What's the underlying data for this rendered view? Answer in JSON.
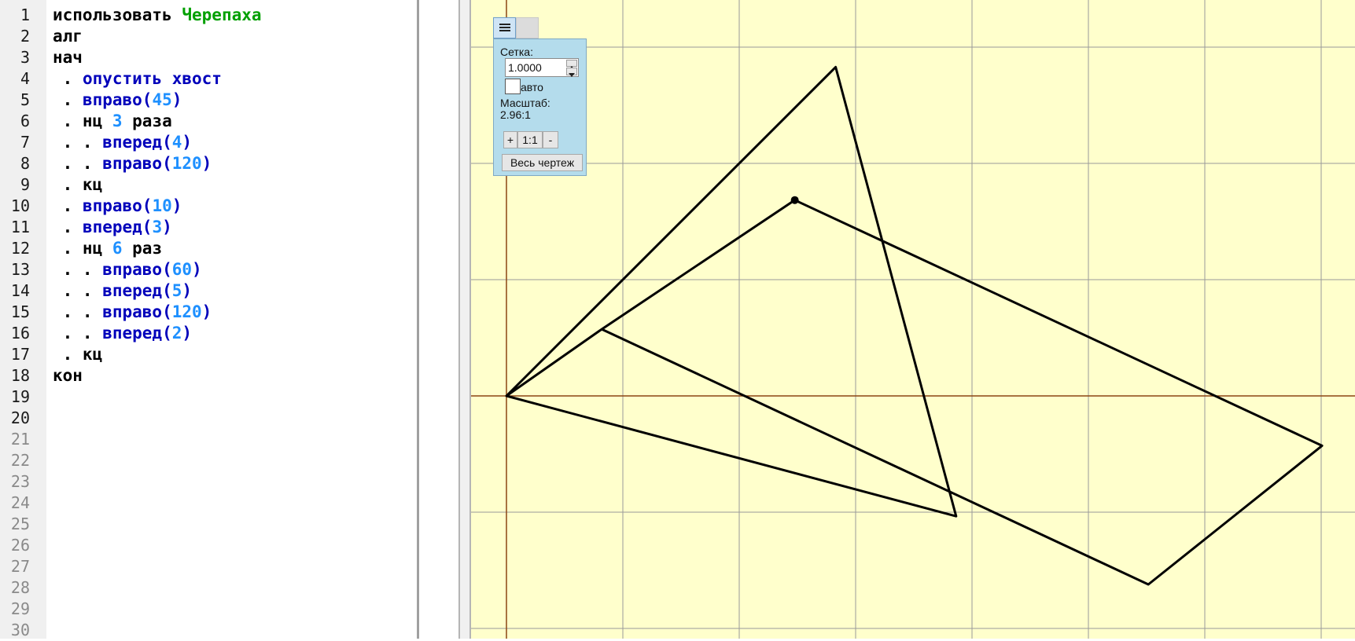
{
  "editor": {
    "line_numbers": [
      "1",
      "2",
      "3",
      "4",
      "5",
      "6",
      "7",
      "8",
      "9",
      "10",
      "11",
      "12",
      "13",
      "14",
      "15",
      "16",
      "17",
      "18",
      "19",
      "20",
      "21",
      "22",
      "23",
      "24",
      "25",
      "26",
      "27",
      "28",
      "29",
      "30"
    ],
    "lines": [
      [
        {
          "t": "использовать ",
          "c": "kw"
        },
        {
          "t": "Черепаха",
          "c": "mod"
        }
      ],
      [
        {
          "t": "алг",
          "c": "kw"
        }
      ],
      [
        {
          "t": "нач",
          "c": "kw"
        }
      ],
      [
        {
          "t": " . ",
          "c": "kw"
        },
        {
          "t": "опустить хвост",
          "c": "cmd"
        }
      ],
      [
        {
          "t": " . ",
          "c": "kw"
        },
        {
          "t": "вправо",
          "c": "cmd"
        },
        {
          "t": "(",
          "c": "par"
        },
        {
          "t": "45",
          "c": "num"
        },
        {
          "t": ")",
          "c": "par"
        }
      ],
      [
        {
          "t": " . нц ",
          "c": "kw"
        },
        {
          "t": "3",
          "c": "num"
        },
        {
          "t": " раза",
          "c": "kw"
        }
      ],
      [
        {
          "t": " . . ",
          "c": "kw"
        },
        {
          "t": "вперед",
          "c": "cmd"
        },
        {
          "t": "(",
          "c": "par"
        },
        {
          "t": "4",
          "c": "num"
        },
        {
          "t": ")",
          "c": "par"
        }
      ],
      [
        {
          "t": " . . ",
          "c": "kw"
        },
        {
          "t": "вправо",
          "c": "cmd"
        },
        {
          "t": "(",
          "c": "par"
        },
        {
          "t": "120",
          "c": "num"
        },
        {
          "t": ")",
          "c": "par"
        }
      ],
      [
        {
          "t": " . кц",
          "c": "kw"
        }
      ],
      [
        {
          "t": " . ",
          "c": "kw"
        },
        {
          "t": "вправо",
          "c": "cmd"
        },
        {
          "t": "(",
          "c": "par"
        },
        {
          "t": "10",
          "c": "num"
        },
        {
          "t": ")",
          "c": "par"
        }
      ],
      [
        {
          "t": " . ",
          "c": "kw"
        },
        {
          "t": "вперед",
          "c": "cmd"
        },
        {
          "t": "(",
          "c": "par"
        },
        {
          "t": "3",
          "c": "num"
        },
        {
          "t": ")",
          "c": "par"
        }
      ],
      [
        {
          "t": " . нц ",
          "c": "kw"
        },
        {
          "t": "6",
          "c": "num"
        },
        {
          "t": " раз",
          "c": "kw"
        }
      ],
      [
        {
          "t": " . . ",
          "c": "kw"
        },
        {
          "t": "вправо",
          "c": "cmd"
        },
        {
          "t": "(",
          "c": "par"
        },
        {
          "t": "60",
          "c": "num"
        },
        {
          "t": ")",
          "c": "par"
        }
      ],
      [
        {
          "t": " . . ",
          "c": "kw"
        },
        {
          "t": "вперед",
          "c": "cmd"
        },
        {
          "t": "(",
          "c": "par"
        },
        {
          "t": "5",
          "c": "num"
        },
        {
          "t": ")",
          "c": "par"
        }
      ],
      [
        {
          "t": " . . ",
          "c": "kw"
        },
        {
          "t": "вправо",
          "c": "cmd"
        },
        {
          "t": "(",
          "c": "par"
        },
        {
          "t": "120",
          "c": "num"
        },
        {
          "t": ")",
          "c": "par"
        }
      ],
      [
        {
          "t": " . . ",
          "c": "kw"
        },
        {
          "t": "вперед",
          "c": "cmd"
        },
        {
          "t": "(",
          "c": "par"
        },
        {
          "t": "2",
          "c": "num"
        },
        {
          "t": ")",
          "c": "par"
        }
      ],
      [
        {
          "t": " . кц",
          "c": "kw"
        }
      ],
      [
        {
          "t": "кон",
          "c": "kw"
        }
      ]
    ]
  },
  "drawing_panel": {
    "grid_label": "Сетка:",
    "grid_value": "1.0000",
    "auto_label": "авто",
    "auto_checked": false,
    "scale_label": "Масштаб:",
    "scale_value": "2.96:1",
    "zoom_in_label": "+",
    "zoom_reset_label": "1:1",
    "zoom_out_label": "-",
    "fit_all_label": "Весь чертеж"
  },
  "turtle": {
    "grid_step": 1,
    "path": [
      [
        0,
        0
      ],
      [
        2.8284,
        2.8284
      ],
      [
        3.8637,
        -1.0353
      ],
      [
        0,
        0
      ],
      [
        0.8192,
        0.5736
      ],
      [
        2.4773,
        1.6845
      ],
      [
        7.0073,
        -0.4286
      ],
      [
        5.5149,
        -1.6217
      ],
      [
        0.8192,
        0.5736
      ]
    ],
    "position": [
      2.4773,
      1.6845
    ]
  },
  "colors": {
    "canvas_bg": "#ffffcc",
    "grid_line": "#9a9a9a",
    "axis_line": "#8b4513",
    "path_line": "#000000",
    "panel_bg": "#b4dcec"
  }
}
